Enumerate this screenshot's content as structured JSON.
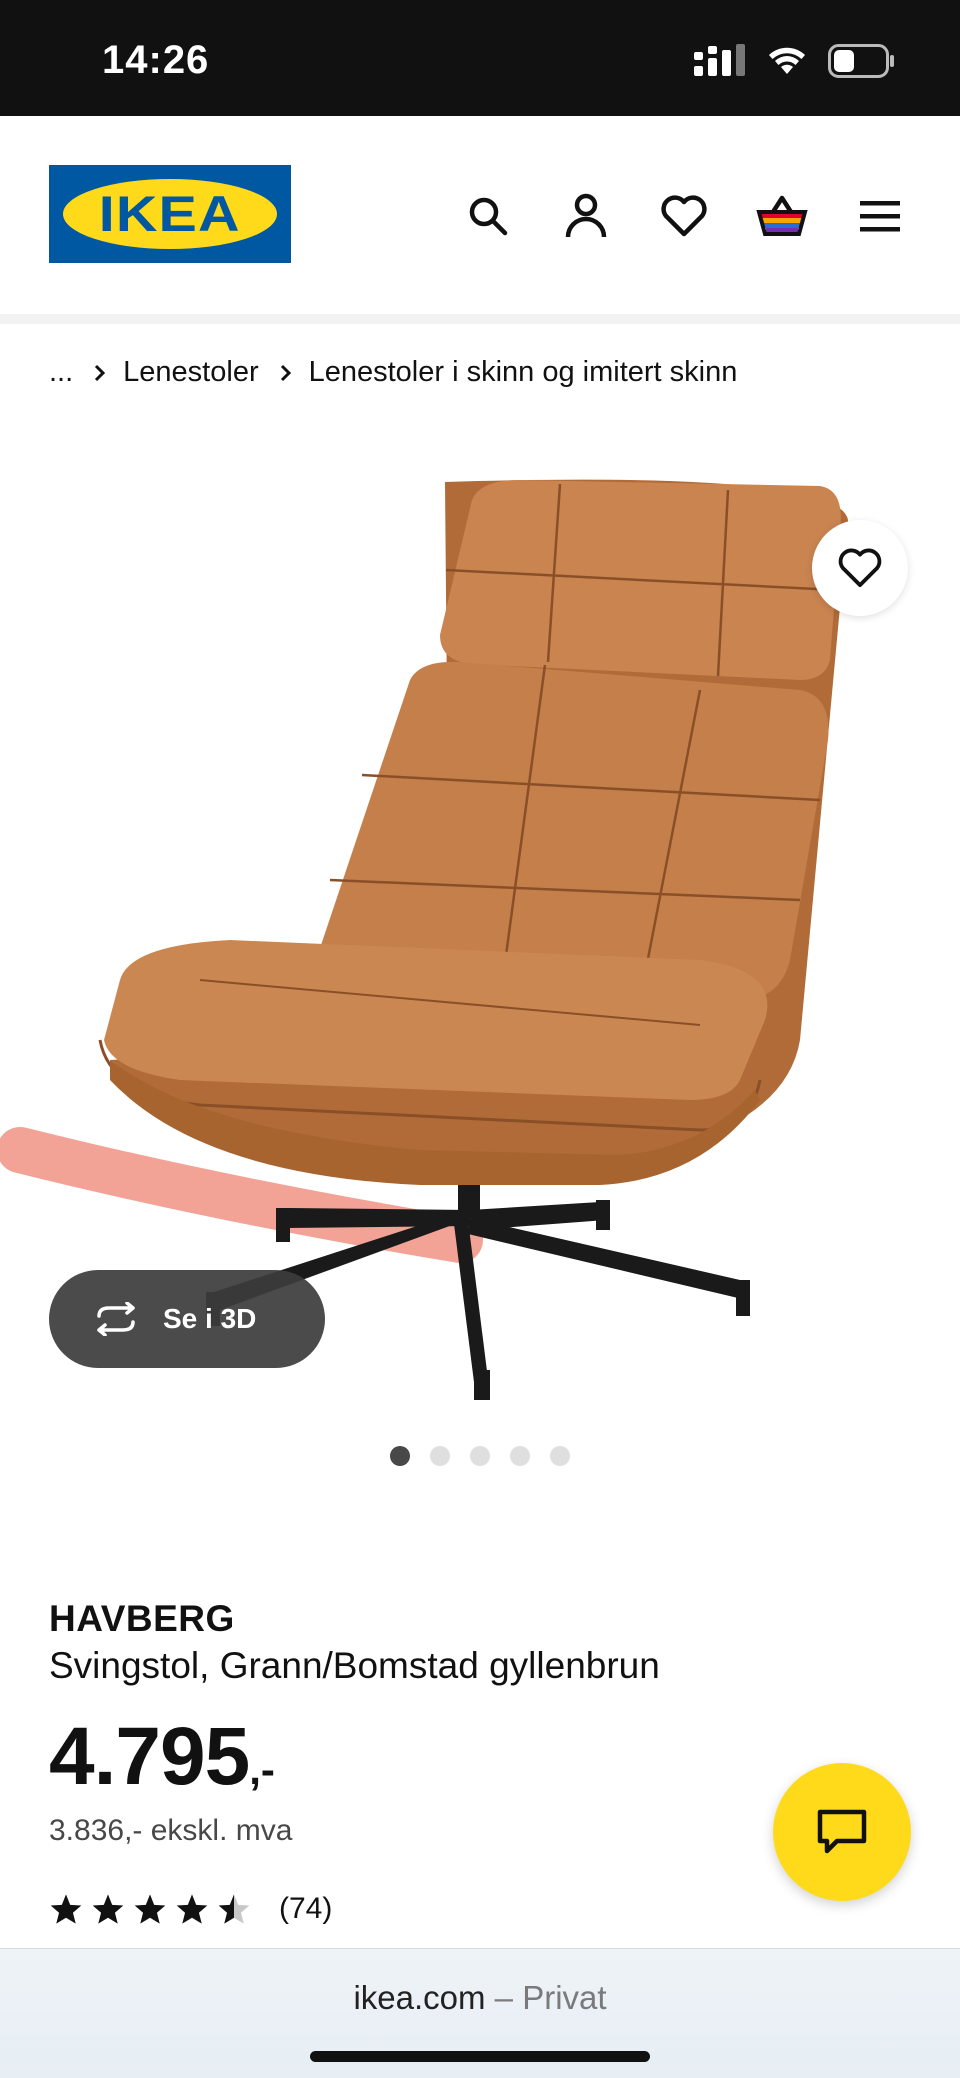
{
  "status_bar": {
    "time": "14:26"
  },
  "header": {
    "logo_text": "IKEA",
    "icons": [
      "search-icon",
      "account-icon",
      "favourites-icon",
      "cart-icon",
      "menu-icon"
    ]
  },
  "breadcrumb": {
    "ellipsis": "...",
    "items": [
      "Lenestoler",
      "Lenestoler i skinn og imitert skinn"
    ]
  },
  "gallery": {
    "view_3d_label": "Se i 3D",
    "image_count": 5,
    "active_index": 0
  },
  "product": {
    "name": "HAVBERG",
    "description": "Svingstol, Grann/Bomstad gyllenbrun",
    "price_main": "4.795",
    "price_suffix": ",-",
    "price_excl_vat": "3.836,- ekskl. mva",
    "rating_value": 4.5,
    "rating_max": 5,
    "review_count": "(74)"
  },
  "browser": {
    "domain": "ikea.com",
    "separator": " – ",
    "mode": "Privat"
  },
  "colors": {
    "ikea_blue": "#0058a3",
    "ikea_yellow": "#ffda1a",
    "leather": "#c07a47",
    "base": "#1a1a1a"
  }
}
